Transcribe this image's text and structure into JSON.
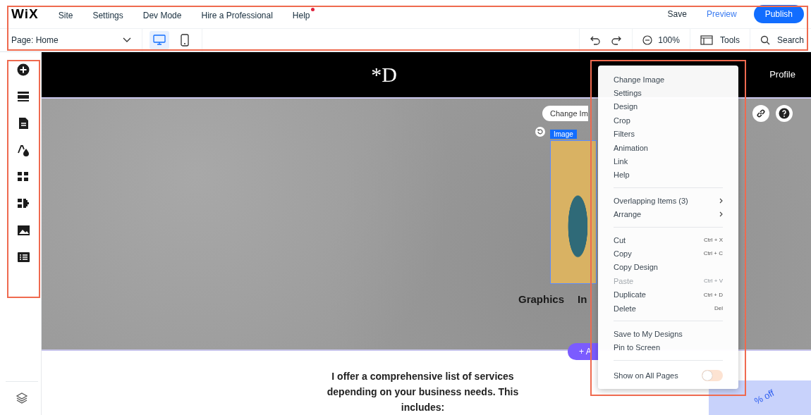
{
  "top_bar": {
    "logo": "WiX",
    "menu": [
      {
        "label": "Site",
        "notification": false
      },
      {
        "label": "Settings",
        "notification": false
      },
      {
        "label": "Dev Mode",
        "notification": false
      },
      {
        "label": "Hire a Professional",
        "notification": false
      },
      {
        "label": "Help",
        "notification": true
      }
    ],
    "save": "Save",
    "preview": "Preview",
    "publish": "Publish"
  },
  "toolbar": {
    "page_selector": "Page: Home",
    "devices": [
      {
        "kind": "desktop",
        "selected": true
      },
      {
        "kind": "mobile",
        "selected": false
      }
    ],
    "zoom": "100%",
    "tools": "Tools",
    "search": "Search"
  },
  "sidebar": {
    "items": [
      {
        "kind": "add"
      },
      {
        "kind": "sections"
      },
      {
        "kind": "pages"
      },
      {
        "kind": "theme"
      },
      {
        "kind": "apps"
      },
      {
        "kind": "addons"
      },
      {
        "kind": "media"
      },
      {
        "kind": "cms"
      }
    ],
    "footer": [
      {
        "kind": "layers"
      }
    ]
  },
  "site": {
    "logo": "*D",
    "nav": [
      "Profile"
    ],
    "hero": {
      "toolbar_button": "Change Im",
      "selection_tag": "Image",
      "captions": [
        "Graphics",
        "In"
      ],
      "add_button": "+ A"
    },
    "intro": "I offer a comprehensive list of services depending on your business needs. This includes:",
    "promo": "% off"
  },
  "context_menu": {
    "groups": [
      [
        {
          "label": "Change Image",
          "submenu": false,
          "disabled": false
        },
        {
          "label": "Settings",
          "submenu": false,
          "disabled": false
        },
        {
          "label": "Design",
          "submenu": false,
          "disabled": false
        },
        {
          "label": "Crop",
          "submenu": false,
          "disabled": false
        },
        {
          "label": "Filters",
          "submenu": false,
          "disabled": false
        },
        {
          "label": "Animation",
          "submenu": false,
          "disabled": false
        },
        {
          "label": "Link",
          "submenu": false,
          "disabled": false
        },
        {
          "label": "Help",
          "submenu": false,
          "disabled": false
        }
      ],
      [
        {
          "label": "Overlapping Items (3)",
          "submenu": true,
          "disabled": false
        },
        {
          "label": "Arrange",
          "submenu": true,
          "disabled": false
        }
      ],
      [
        {
          "label": "Cut",
          "shortcut": "Ctrl + X",
          "submenu": false,
          "disabled": false
        },
        {
          "label": "Copy",
          "shortcut": "Ctrl + C",
          "submenu": false,
          "disabled": false
        },
        {
          "label": "Copy Design",
          "submenu": false,
          "disabled": false
        },
        {
          "label": "Paste",
          "shortcut": "Ctrl + V",
          "submenu": false,
          "disabled": true
        },
        {
          "label": "Duplicate",
          "shortcut": "Ctrl + D",
          "submenu": false,
          "disabled": false
        },
        {
          "label": "Delete",
          "shortcut": "Del",
          "submenu": false,
          "disabled": false
        }
      ],
      [
        {
          "label": "Save to My Designs",
          "submenu": false,
          "disabled": false
        },
        {
          "label": "Pin to Screen",
          "submenu": false,
          "disabled": false
        }
      ]
    ],
    "toggle": {
      "label": "Show on All Pages",
      "on": false
    }
  }
}
